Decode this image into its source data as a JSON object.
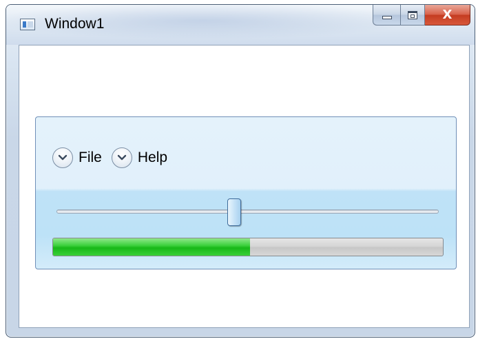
{
  "window": {
    "title": "Window1",
    "close_glyph": "X"
  },
  "menu": {
    "items": [
      {
        "label": "File",
        "icon": "chevron-down-icon"
      },
      {
        "label": "Help",
        "icon": "chevron-down-icon"
      }
    ]
  },
  "slider": {
    "value_fraction": 0.465
  },
  "progress": {
    "value_fraction": 0.505
  },
  "colors": {
    "progress_fill": "#22c022",
    "panel_top": "#e4f2fb",
    "panel_bottom": "#bde2f7",
    "close_button": "#c43c21"
  }
}
